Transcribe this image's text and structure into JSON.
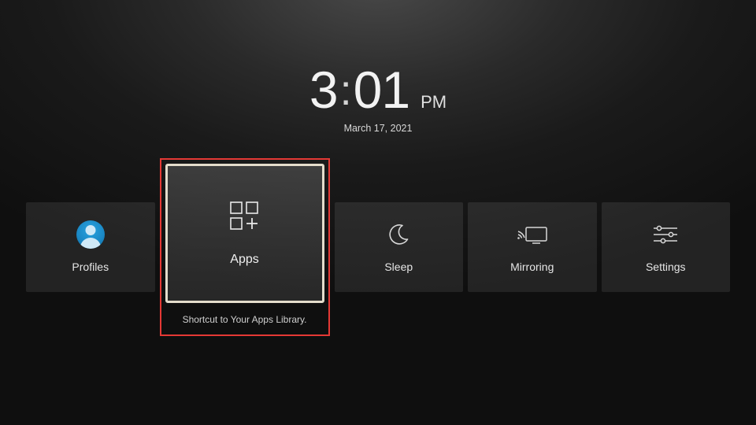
{
  "clock": {
    "hour": "3",
    "minute": "01",
    "suffix": "PM",
    "date": "March 17, 2021"
  },
  "tiles": {
    "profiles": {
      "label": "Profiles"
    },
    "apps": {
      "label": "Apps",
      "caption": "Shortcut to Your Apps Library."
    },
    "sleep": {
      "label": "Sleep"
    },
    "mirroring": {
      "label": "Mirroring"
    },
    "settings": {
      "label": "Settings"
    }
  }
}
